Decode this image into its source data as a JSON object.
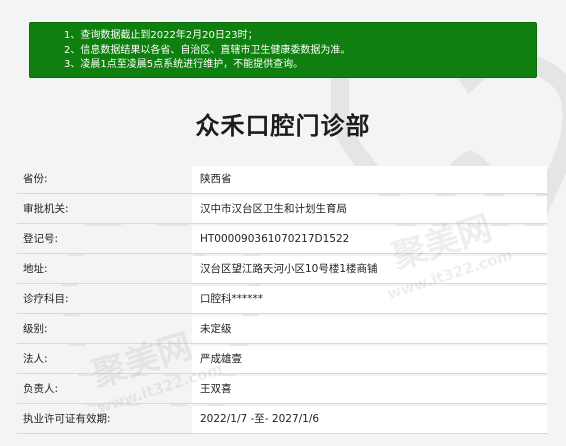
{
  "notice": {
    "lines": [
      "1、查询数据截止到2022年2月20日23时；",
      "2、信息数据结果以各省、自治区、直辖市卫生健康委数据为准。",
      "3、凌晨1点至凌晨5点系统进行维护，不能提供查询。"
    ]
  },
  "page_title": "众禾口腔门诊部",
  "rows": [
    {
      "label": "省份:",
      "value": "陕西省"
    },
    {
      "label": "审批机关:",
      "value": "汉中市汉台区卫生和计划生育局"
    },
    {
      "label": "登记号:",
      "value": "HT000090361070217D1522"
    },
    {
      "label": "地址:",
      "value": "汉台区望江路天河小区10号楼1楼商铺"
    },
    {
      "label": "诊疗科目:",
      "value": "口腔科******"
    },
    {
      "label": "级别:",
      "value": "未定级"
    },
    {
      "label": "法人:",
      "value": "严成雄壹"
    },
    {
      "label": "负责人:",
      "value": "王双喜"
    },
    {
      "label": "执业许可证有效期:",
      "value": "2022/1/7 -至- 2027/1/6"
    }
  ],
  "watermark": {
    "brand": "聚美网",
    "url": "www.it322.com"
  },
  "colors": {
    "notice_bg": "#0f7f0f",
    "page_bg": "#f4f4f4"
  }
}
